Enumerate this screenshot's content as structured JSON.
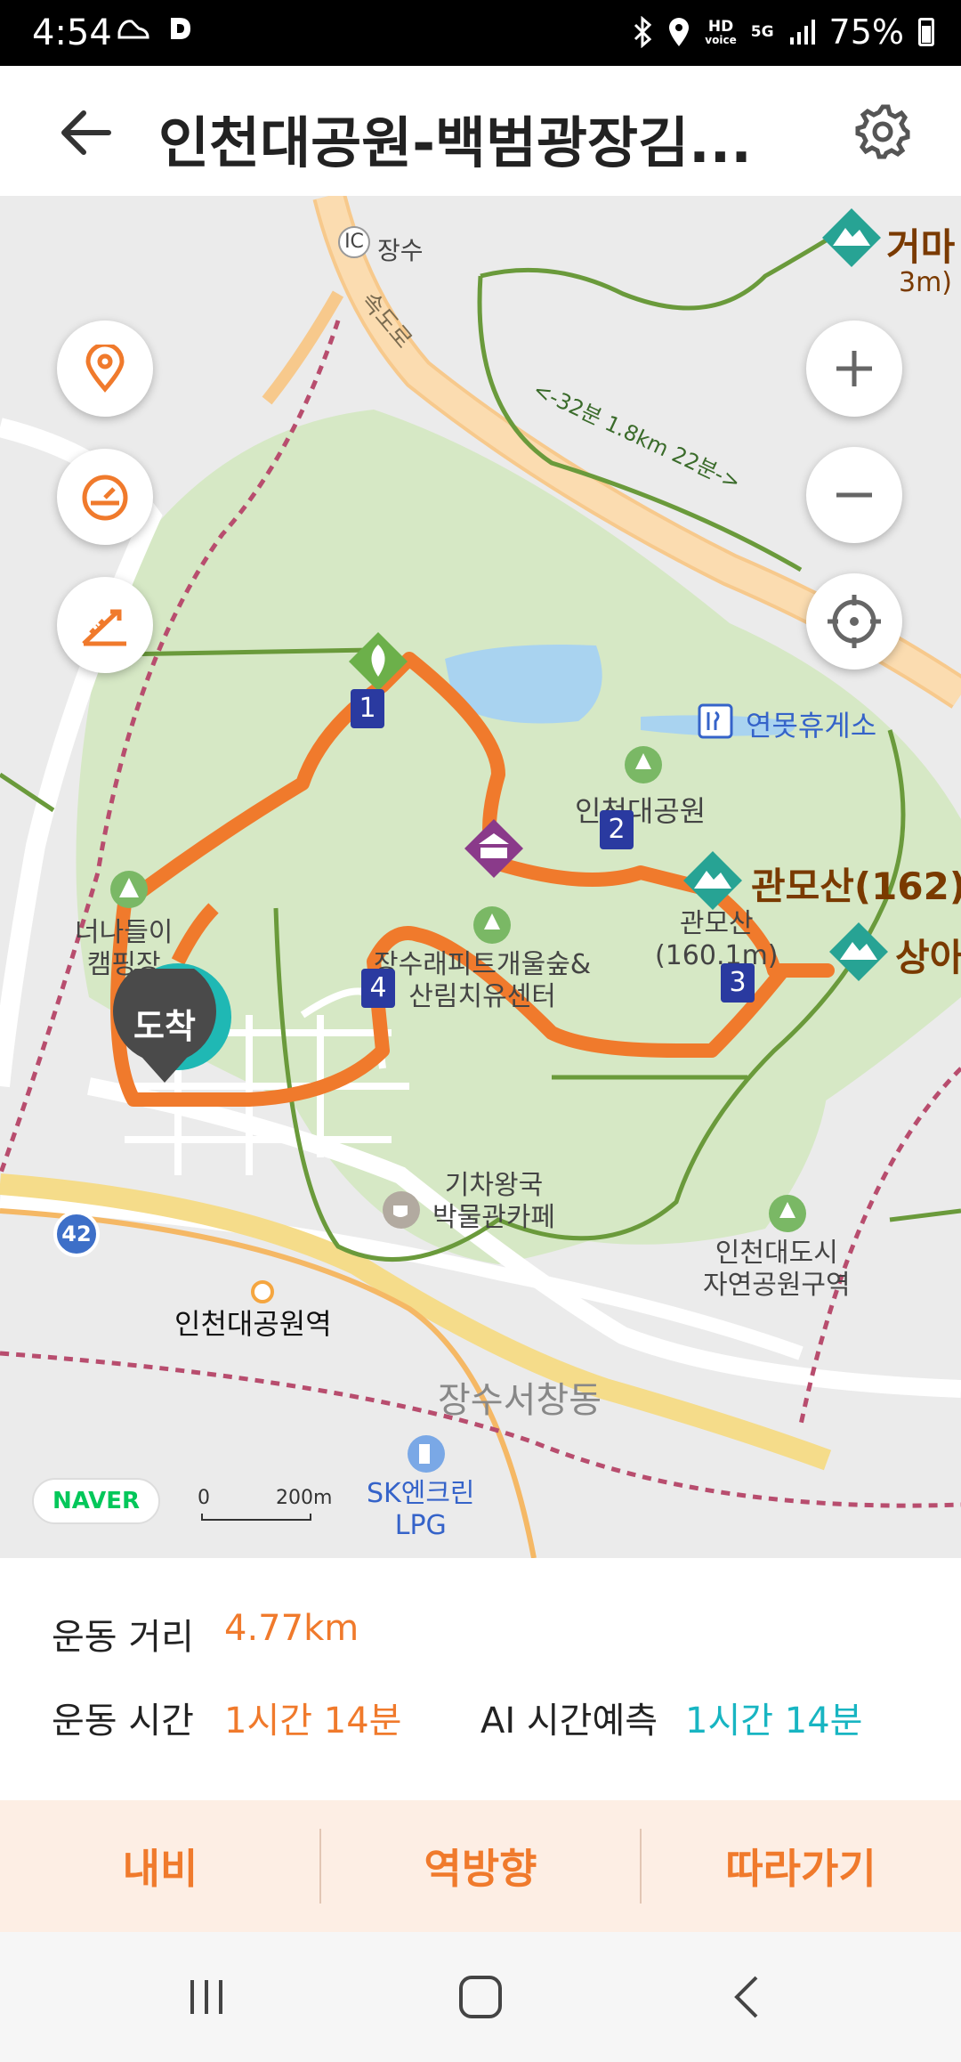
{
  "status": {
    "time": "4:54",
    "left_icons": [
      "shoe-icon",
      "d-app-icon"
    ],
    "right_icons": [
      "bluetooth-icon",
      "location-icon",
      "hd-voice-icon",
      "5g-icon",
      "signal-icon"
    ],
    "hd_label": "HD",
    "voice_label": "voice",
    "net_label": "5G",
    "battery": "75%"
  },
  "header": {
    "title": "인천대공원-백범광장김..."
  },
  "map": {
    "labels": {
      "ic": "IC",
      "jangsu": "장수",
      "expressway": "속도로",
      "gwanmo_top": "거마",
      "gwanmo_top_sub": "3m)",
      "road_sign": "<-32분 1.8km 22분->",
      "rest_area": "연못휴게소",
      "park": "인천대공원",
      "gwanmosan": "관모산(162)",
      "gwanmosan_sub": "관모산\n(160.1m)",
      "sangi": "상아",
      "camping": "너나들이\n캠핑장",
      "forest": "장수래피트개울숲&\n산림치유센터",
      "cafe": "기차왕국\n박물관카페",
      "nature_area": "인천대도시\n자연공원구역",
      "station": "인천대공원역",
      "district": "장수서창동",
      "gas": "SK엔크린\nLPG",
      "road_number": "42"
    },
    "waypoints": [
      "1",
      "2",
      "3",
      "4"
    ],
    "arrival": "도착",
    "brand": "NAVER",
    "scale_zero": "0",
    "scale_distance": "200m",
    "route_color": "#f07a2c"
  },
  "info": {
    "distance_label": "운동 거리",
    "distance_value": "4.77km",
    "time_label": "운동 시간",
    "time_value": "1시간 14분",
    "ai_label": "AI 시간예측",
    "ai_value": "1시간 14분"
  },
  "actions": {
    "navi": "내비",
    "reverse": "역방향",
    "follow": "따라가기"
  },
  "navbar": [
    "recent-apps-icon",
    "home-icon",
    "back-icon"
  ]
}
